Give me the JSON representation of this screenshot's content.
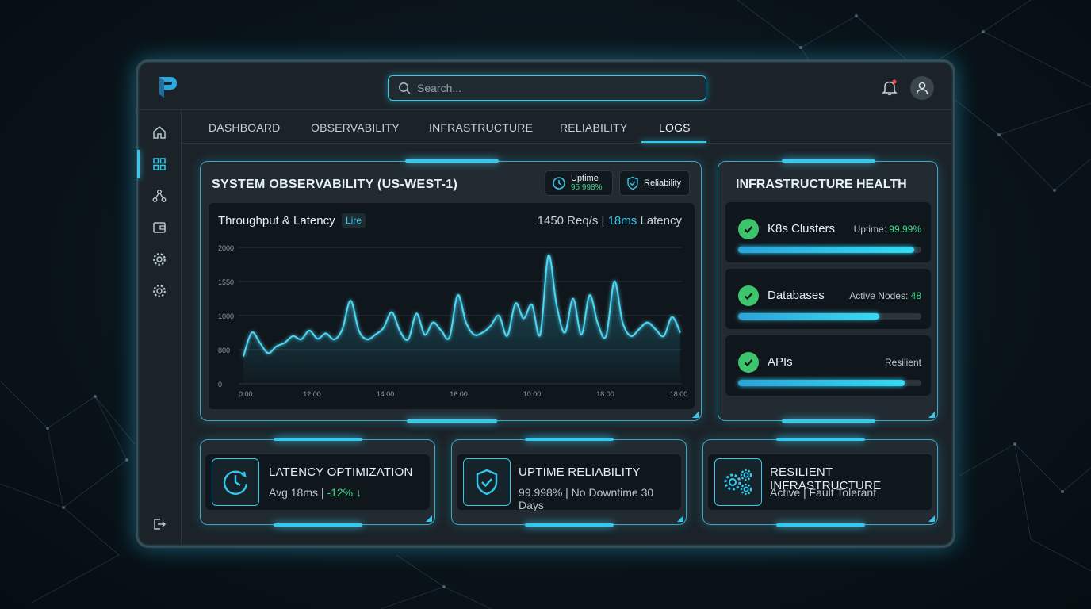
{
  "app": {
    "logo_letter": "P"
  },
  "search": {
    "placeholder": "Search..."
  },
  "tabs": [
    "DASHBOARD",
    "OBSERVABILITY",
    "INFRASTRUCTURE",
    "RELIABILITY",
    "LOGS"
  ],
  "active_tab": "LOGS",
  "sidebar": {
    "icons": [
      "home-icon",
      "grid-icon",
      "nodes-icon",
      "wallet-icon",
      "gear-icon",
      "gear-icon"
    ],
    "bottom_icon": "logout-icon"
  },
  "observability": {
    "title": "SYSTEM OBSERVABILITY (US-WEST-1)",
    "uptime_badge": {
      "label": "Uptime",
      "value": "95 998%"
    },
    "reliability_badge": {
      "label": "Reliability"
    },
    "chart_title": "Throughput & Latency",
    "live_tag": "Lire",
    "metric_req": "1450 Req/s | ",
    "metric_latency": "18ms",
    "metric_latency_suffix": " Latency"
  },
  "chart_data": {
    "type": "area",
    "x_ticks": [
      "0:00",
      "12:00",
      "14:00",
      "16:00",
      "10:00",
      "18:00",
      "18:00"
    ],
    "y_ticks": [
      "0",
      "800",
      "1000",
      "1550",
      "2000"
    ],
    "ylim": [
      0,
      2000
    ],
    "series": [
      {
        "values": [
          400,
          750,
          600,
          450,
          550,
          600,
          700,
          650,
          780,
          660,
          740,
          650,
          800,
          1220,
          780,
          650,
          720,
          820,
          1050,
          770,
          650,
          1030,
          720,
          900,
          780,
          680,
          1300,
          900,
          720,
          750,
          850,
          1000,
          700,
          1180,
          960,
          1160,
          720,
          1880,
          1150,
          750,
          1250,
          720,
          1300,
          880,
          700,
          1500,
          900,
          700,
          800,
          900,
          800,
          700,
          980,
          750
        ]
      }
    ]
  },
  "infra": {
    "title": "INFRASTRUCTURE HEALTH",
    "items": [
      {
        "name": "K8s Clusters",
        "stat_label": "Uptime: ",
        "stat_value": "99.99%",
        "progress": 0.96
      },
      {
        "name": "Databases",
        "stat_label": "Active Nodes: ",
        "stat_value": "48",
        "progress": 0.77
      },
      {
        "name": "APIs",
        "stat_label": "Resilient",
        "stat_value": "",
        "progress": 0.91
      }
    ]
  },
  "features": [
    {
      "title": "LATENCY OPTIMIZATION",
      "sub": "Avg 18ms | ",
      "sub_highlight": "-12% ↓",
      "icon": "clock-icon"
    },
    {
      "title": "UPTIME RELIABILITY",
      "sub": "99.998% | No Downtime 30 Days",
      "sub_highlight": "",
      "icon": "shield-check-icon"
    },
    {
      "title": "RESILIENT INFRASTRUCTURE",
      "sub": "Active | Fault Tolerant",
      "sub_highlight": "",
      "icon": "gears-icon"
    }
  ],
  "colors": {
    "accent": "#33c9ee",
    "success": "#3ec46d",
    "success_text": "#3fd88a"
  }
}
